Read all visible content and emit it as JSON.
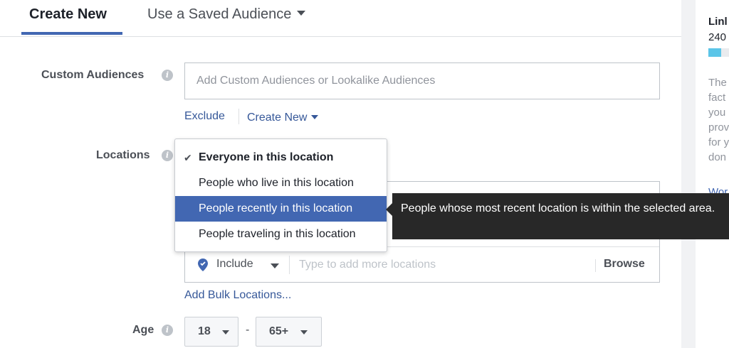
{
  "tabs": {
    "create_new": "Create New",
    "use_saved": "Use a Saved Audience"
  },
  "custom_audiences": {
    "label": "Custom Audiences",
    "placeholder": "Add Custom Audiences or Lookalike Audiences",
    "exclude": "Exclude",
    "create_new": "Create New"
  },
  "locations": {
    "label": "Locations",
    "menu": [
      {
        "label": "Everyone in this location",
        "checked": true
      },
      {
        "label": "People who live in this location",
        "checked": false
      },
      {
        "label": "People recently in this location",
        "checked": false,
        "hovered": true
      },
      {
        "label": "People traveling in this location",
        "checked": false
      }
    ],
    "tooltip": "People whose most recent location is within the selected area.",
    "include_label": "Include",
    "input_placeholder": "Type to add more locations",
    "browse": "Browse",
    "add_bulk": "Add Bulk Locations..."
  },
  "age": {
    "label": "Age",
    "min": "18",
    "dash": "-",
    "max": "65+"
  },
  "right_panel": {
    "title": "Linl",
    "number": "240",
    "text": "The\nfact\nyou\nprov\nfor y\ndon",
    "link": "Wor"
  },
  "colors": {
    "accent": "#4267b2",
    "link": "#365899",
    "tooltip_bg": "#282828"
  }
}
